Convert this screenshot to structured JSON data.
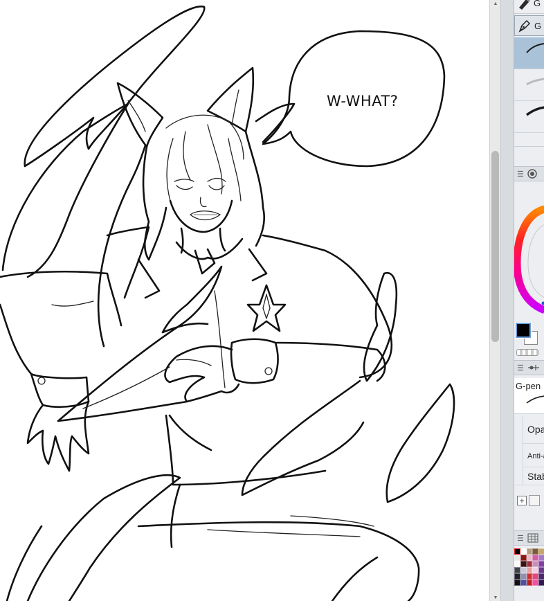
{
  "canvas": {
    "speech_bubble_text": "W-WHAT?"
  },
  "scrollbar": {
    "up_arrow": "▲",
    "down_arrow": "▼"
  },
  "tool_panel": {
    "items": [
      {
        "label": "G",
        "icon": "pencil-marker-icon"
      },
      {
        "label": "G",
        "icon": "pen-nib-icon"
      }
    ],
    "brush_previews": [
      {
        "selected": true
      },
      {
        "selected": false
      },
      {
        "selected": false
      }
    ]
  },
  "color_panel": {
    "main_color": "#000000",
    "sub_color": "#ffffff"
  },
  "tool_property": {
    "brush_name": "G-pen",
    "opacity_label": "Opa",
    "antialias_label": "Anti-a",
    "stabilization_label": "Stab"
  },
  "color_set": {
    "swatches": [
      "#000000",
      "#ffffff",
      "#b39b80",
      "#7a5a3a",
      "#c8a86a",
      "#e8e8e8",
      "#8a1a1a",
      "#e8b8c8",
      "#d060a0",
      "#a878c8",
      "#fafafa",
      "#3a1010",
      "#a03040",
      "#c890b8",
      "#8040a0",
      "#404048",
      "#c8c8d8",
      "#e8a0a0",
      "#f0d0e0",
      "#6a3a8a",
      "#202028",
      "#9090b0",
      "#d03030",
      "#e04880",
      "#4a2a6a",
      "#101018",
      "#5050a0",
      "#c02020",
      "#f050a0",
      "#301850"
    ]
  }
}
